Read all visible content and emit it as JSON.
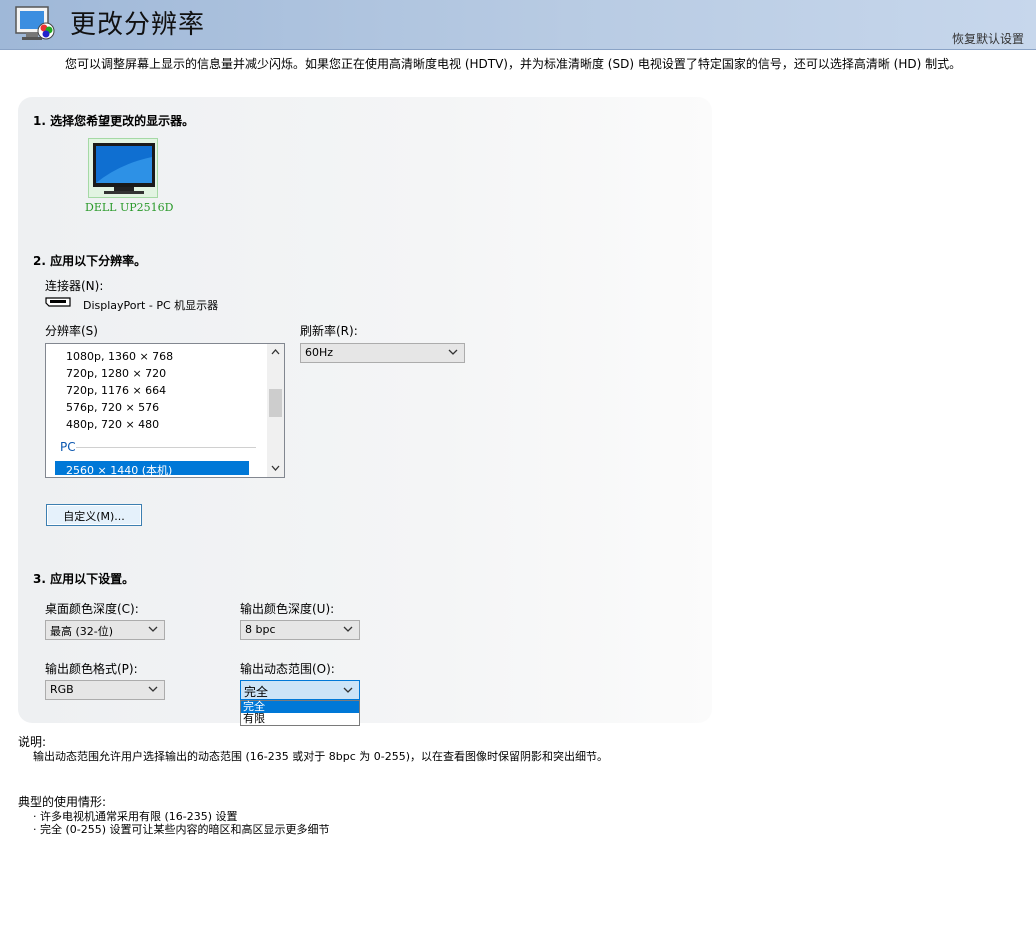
{
  "header": {
    "title": "更改分辨率",
    "restore_link": "恢复默认设置"
  },
  "intro": "您可以调整屏幕上显示的信息量并减少闪烁。如果您正在使用高清晰度电视 (HDTV)，并为标准清晰度 (SD) 电视设置了特定国家的信号，还可以选择高清晰 (HD) 制式。",
  "step1": {
    "title": "1. 选择您希望更改的显示器。",
    "monitor_name": "DELL UP2516D"
  },
  "step2": {
    "title": "2. 应用以下分辨率。",
    "connector_label": "连接器(N):",
    "connector_value": "DisplayPort - PC 机显示器",
    "resolution_label": "分辨率(S)",
    "resolutions": [
      "1080p, 1360 × 768",
      "720p, 1280 × 720",
      "720p, 1176 × 664",
      "576p, 720 × 576",
      "480p, 720 × 480"
    ],
    "pc_group": "PC",
    "pc_selected": "2560 × 1440 (本机)",
    "refresh_label": "刷新率(R):",
    "refresh_value": "60Hz",
    "custom_button": "自定义(M)..."
  },
  "step3": {
    "title": "3. 应用以下设置。",
    "desktop_depth_label": "桌面颜色深度(C):",
    "desktop_depth_value": "最高 (32-位)",
    "output_depth_label": "输出颜色深度(U):",
    "output_depth_value": "8 bpc",
    "output_format_label": "输出颜色格式(P):",
    "output_format_value": "RGB",
    "dynamic_range_label": "输出动态范围(O):",
    "dynamic_range_value": "完全",
    "dynamic_range_options": [
      "完全",
      "有限"
    ]
  },
  "description": {
    "label": "说明:",
    "text": "输出动态范围允许用户选择输出的动态范围 (16-235 或对于 8bpc 为 0-255)，以在查看图像时保留阴影和突出细节。"
  },
  "usage": {
    "label": "典型的使用情形:",
    "items": [
      "许多电视机通常采用有限 (16-235) 设置",
      "完全 (0-255) 设置可让某些内容的暗区和高区显示更多细节"
    ]
  },
  "colors": {
    "header_bg": "#b0c6e2",
    "selected": "#0078d7",
    "monitor_label": "#2a9a2a",
    "pc_group": "#0b57b0"
  }
}
